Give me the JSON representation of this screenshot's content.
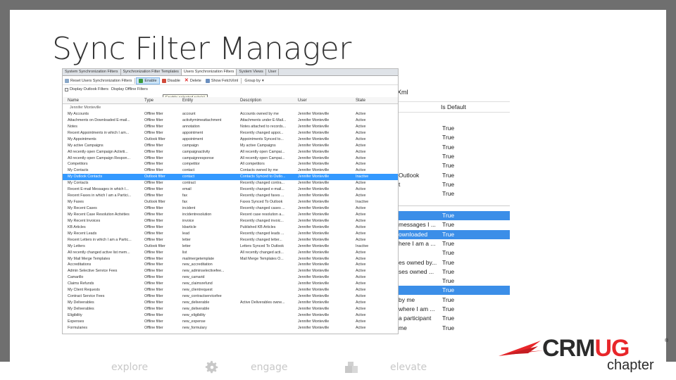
{
  "slide": {
    "title": "Sync Filter Manager"
  },
  "tabs": [
    "System Synchronization Filters",
    "Synchronization Filter Templates",
    "Users Synchronization Filters",
    "System Views",
    "User"
  ],
  "active_tab": 2,
  "toolbar": {
    "reset_label": "Reset Users Synchronization Filters",
    "enable_label": "Enable",
    "disable_label": "Disable",
    "delete_label": "Delete",
    "show_fetch_label": "Show FetchXml",
    "group_by_label": "Group by"
  },
  "viewbar": {
    "label": "Display Outlook Filters",
    "label2": "Display Offline Filters"
  },
  "tooltip": "Enable selected rule(s)",
  "grid": {
    "headers": [
      "Name",
      "Type",
      "Entity",
      "Description",
      "User",
      "State"
    ],
    "group": "Jennifer Monteville",
    "rows": [
      [
        "My Accounts",
        "Offline filter",
        "account",
        "Accounts owned by me",
        "Jennifer Monteville",
        "Active"
      ],
      [
        "Attachments on Downloaded E-mail...",
        "Offline filter",
        "activitymimeattachment",
        "Attachments under E-Mail...",
        "Jennifer Monteville",
        "Active"
      ],
      [
        "Notes",
        "Offline filter",
        "annotation",
        "Notes attached to records...",
        "Jennifer Monteville",
        "Active"
      ],
      [
        "Recent Appointments in which I am...",
        "Offline filter",
        "appointment",
        "Recently changed appoi...",
        "Jennifer Monteville",
        "Active"
      ],
      [
        "My Appointments",
        "Outlook filter",
        "appointment",
        "Appointments Synced to...",
        "Jennifer Monteville",
        "Active"
      ],
      [
        "My active Campaigns",
        "Offline filter",
        "campaign",
        "My active Campaigns",
        "Jennifer Monteville",
        "Active"
      ],
      [
        "All recently open Campaign Activiti...",
        "Offline filter",
        "campaignactivity",
        "All recently open Campai...",
        "Jennifer Monteville",
        "Active"
      ],
      [
        "All recently open Campaign Respon...",
        "Offline filter",
        "campaignresponse",
        "All recently open Campai...",
        "Jennifer Monteville",
        "Active"
      ],
      [
        "Competitors",
        "Offline filter",
        "competitor",
        "All competitors",
        "Jennifer Monteville",
        "Active"
      ],
      [
        "My Contacts",
        "Offline filter",
        "contact",
        "Contacts owned by me",
        "Jennifer Monteville",
        "Active"
      ],
      [
        "My Outlook Contacts",
        "Outlook filter",
        "contact",
        "Contacts Synced to Outlo...",
        "Jennifer Monteville",
        "Inactive"
      ],
      [
        "My Contacts",
        "Offline filter",
        "contract",
        "Recently changed contra...",
        "Jennifer Monteville",
        "Active"
      ],
      [
        "Recent E-mail Messages in which I...",
        "Offline filter",
        "email",
        "Recently changed e-mail...",
        "Jennifer Monteville",
        "Active"
      ],
      [
        "Recent Faxes in which I am a Partici...",
        "Offline filter",
        "fax",
        "Recently changed faxes ...",
        "Jennifer Monteville",
        "Active"
      ],
      [
        "My Faxes",
        "Outlook filter",
        "fax",
        "Faxes Synced To Outlook",
        "Jennifer Monteville",
        "Inactive"
      ],
      [
        "My Recent Cases",
        "Offline filter",
        "incident",
        "Recently changed cases ...",
        "Jennifer Monteville",
        "Active"
      ],
      [
        "My Recent Case Resolution Activities",
        "Offline filter",
        "incidentresolution",
        "Recent case resolution a...",
        "Jennifer Monteville",
        "Active"
      ],
      [
        "My Recent Invoices",
        "Offline filter",
        "invoice",
        "Recently changed invoic...",
        "Jennifer Monteville",
        "Active"
      ],
      [
        "KB Articles",
        "Offline filter",
        "kbarticle",
        "Published KB Articles",
        "Jennifer Monteville",
        "Active"
      ],
      [
        "My Recent Leads",
        "Offline filter",
        "lead",
        "Recently changed leads ...",
        "Jennifer Monteville",
        "Active"
      ],
      [
        "Recent Letters in which I am a Partic...",
        "Offline filter",
        "letter",
        "Recently changed letter...",
        "Jennifer Monteville",
        "Active"
      ],
      [
        "My Letters",
        "Outlook filter",
        "letter",
        "Letters Synced To Outlook",
        "Jennifer Monteville",
        "Inactive"
      ],
      [
        "All recently changed active list mem...",
        "Offline filter",
        "list",
        "All recently changed acti...",
        "Jennifer Monteville",
        "Active"
      ],
      [
        "My Mail Merge Templates",
        "Offline filter",
        "mailmergetemplate",
        "Mail Merge Templates O...",
        "Jennifer Monteville",
        "Active"
      ],
      [
        "Accreditations",
        "Offline filter",
        "new_accreditation",
        "",
        "Jennifer Monteville",
        "Active"
      ],
      [
        "Admin Selective Service Fees",
        "Offline filter",
        "new_adminselectivefee...",
        "",
        "Jennifer Monteville",
        "Active"
      ],
      [
        "Camarillo",
        "Offline filter",
        "new_camarid",
        "",
        "Jennifer Monteville",
        "Active"
      ],
      [
        "Claims Refunds",
        "Offline filter",
        "new_claimsrefund",
        "",
        "Jennifer Monteville",
        "Active"
      ],
      [
        "My Client Requests",
        "Offline filter",
        "new_clientrequest",
        "",
        "Jennifer Monteville",
        "Active"
      ],
      [
        "Contract Service Fees",
        "Offline filter",
        "new_contractservicefee",
        "",
        "Jennifer Monteville",
        "Active"
      ],
      [
        "My Deliverables",
        "Offline filter",
        "new_deliverable",
        "Active Deliverables owne...",
        "Jennifer Monteville",
        "Active"
      ],
      [
        "My Deliverables",
        "Offline filter",
        "new_deliverable",
        "",
        "Jennifer Monteville",
        "Active"
      ],
      [
        "Eligibility",
        "Offline filter",
        "new_eligibility",
        "",
        "Jennifer Monteville",
        "Active"
      ],
      [
        "Expenses",
        "Offline filter",
        "new_expense",
        "",
        "Jennifer Monteville",
        "Active"
      ],
      [
        "Formularies",
        "Offline filter",
        "new_formulary",
        "",
        "Jennifer Monteville",
        "Active"
      ]
    ],
    "selected_row": 10
  },
  "back_window": {
    "header": "Xml",
    "col_header": "Is Default",
    "rows": [
      {
        "text": "",
        "value": "True",
        "sel": false
      },
      {
        "text": "",
        "value": "True",
        "sel": false
      },
      {
        "text": "",
        "value": "True",
        "sel": false
      },
      {
        "text": "",
        "value": "True",
        "sel": false
      },
      {
        "text": "",
        "value": "True",
        "sel": false
      },
      {
        "text": "Outlook",
        "value": "True",
        "sel": false
      },
      {
        "text": "t",
        "value": "True",
        "sel": false
      },
      {
        "text": "",
        "value": "True",
        "sel": false
      }
    ],
    "rows2": [
      {
        "text": "",
        "value": "True",
        "sel": true
      },
      {
        "text": "messages I ...",
        "value": "True",
        "sel": false
      },
      {
        "text": "ownloaded",
        "value": "True",
        "sel": true
      },
      {
        "text": "here I am a ...",
        "value": "True",
        "sel": false
      },
      {
        "text": "",
        "value": "True",
        "sel": false
      },
      {
        "text": "es owned by...",
        "value": "True",
        "sel": false
      },
      {
        "text": "ses owned ...",
        "value": "True",
        "sel": false
      },
      {
        "text": "",
        "value": "True",
        "sel": false
      },
      {
        "text": "",
        "value": "True",
        "sel": true
      },
      {
        "text": "by me",
        "value": "True",
        "sel": false
      },
      {
        "text": "where I am ...",
        "value": "True",
        "sel": false
      },
      {
        "text": "a participant",
        "value": "True",
        "sel": false
      },
      {
        "text": "me",
        "value": "True",
        "sel": false
      }
    ]
  },
  "footer": {
    "explore": "explore",
    "engage": "engage",
    "elevate": "elevate"
  },
  "logo": {
    "main_a": "CRM",
    "main_b": "UG",
    "reg": "®",
    "sub": "chapter"
  },
  "colors": {
    "selection": "#3399ff",
    "brand_red": "#e8262a"
  }
}
